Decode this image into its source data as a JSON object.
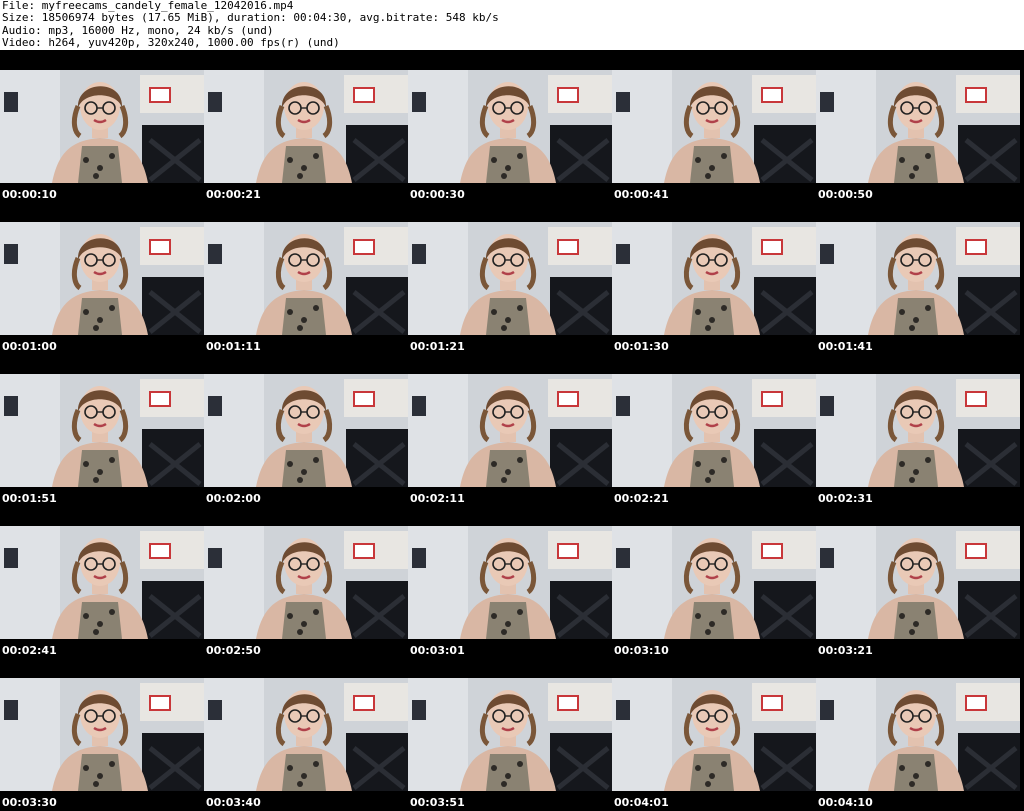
{
  "header": {
    "file_line": "File: myfreecams_candely_female_12042016.mp4",
    "size_line": "Size: 18506974 bytes (17.65 MiB), duration: 00:04:30, avg.bitrate: 548 kb/s",
    "audio_line": "Audio: mp3, 16000 Hz, mono, 24 kb/s (und)",
    "video_line": "Video: h264, yuv420p, 320x240, 1000.00 fps(r) (und)"
  },
  "thumbnails": [
    {
      "time": "00:00:10"
    },
    {
      "time": "00:00:21"
    },
    {
      "time": "00:00:30"
    },
    {
      "time": "00:00:41"
    },
    {
      "time": "00:00:50"
    },
    {
      "time": "00:01:00"
    },
    {
      "time": "00:01:11"
    },
    {
      "time": "00:01:21"
    },
    {
      "time": "00:01:30"
    },
    {
      "time": "00:01:41"
    },
    {
      "time": "00:01:51"
    },
    {
      "time": "00:02:00"
    },
    {
      "time": "00:02:11"
    },
    {
      "time": "00:02:21"
    },
    {
      "time": "00:02:31"
    },
    {
      "time": "00:02:41"
    },
    {
      "time": "00:02:50"
    },
    {
      "time": "00:03:01"
    },
    {
      "time": "00:03:10"
    },
    {
      "time": "00:03:21"
    },
    {
      "time": "00:03:30"
    },
    {
      "time": "00:03:40"
    },
    {
      "time": "00:03:51"
    },
    {
      "time": "00:04:01"
    },
    {
      "time": "00:04:10"
    }
  ],
  "colors": {
    "sheet_background": "#000000",
    "timestamp_text": "#ffffff",
    "header_text": "#000000"
  }
}
